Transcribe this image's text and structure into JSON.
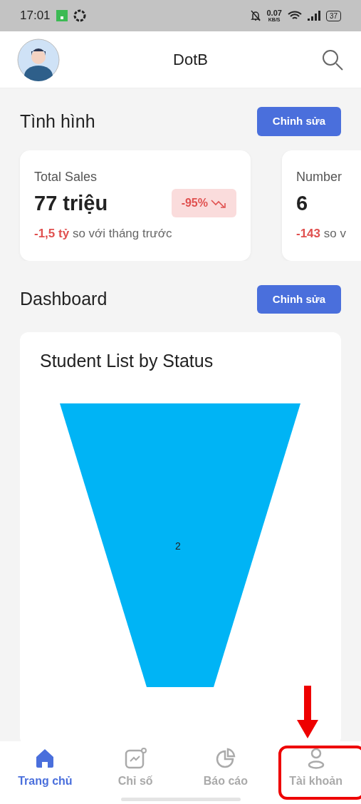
{
  "status_bar": {
    "time": "17:01",
    "speed": "0.07",
    "speed_unit": "KB/S",
    "battery": "37"
  },
  "header": {
    "title": "DotB"
  },
  "overview": {
    "title": "Tình hình",
    "edit_button": "Chỉnh sửa",
    "cards": [
      {
        "label": "Total Sales",
        "value": "77 triệu",
        "change": "-95%",
        "delta": "-1,5 tỷ",
        "comparison": "so với tháng trước"
      },
      {
        "label": "Number",
        "value": "6",
        "delta": "-143",
        "comparison": "so v"
      }
    ]
  },
  "dashboard": {
    "title": "Dashboard",
    "edit_button": "Chỉnh sửa",
    "chart": {
      "title": "Student List by Status",
      "label": "2"
    }
  },
  "tabs": [
    {
      "label": "Trang chủ",
      "selected": true,
      "highlighted": false
    },
    {
      "label": "Chỉ số",
      "selected": false,
      "highlighted": false
    },
    {
      "label": "Báo cáo",
      "selected": false,
      "highlighted": false
    },
    {
      "label": "Tài khoản",
      "selected": false,
      "highlighted": true
    }
  ]
}
